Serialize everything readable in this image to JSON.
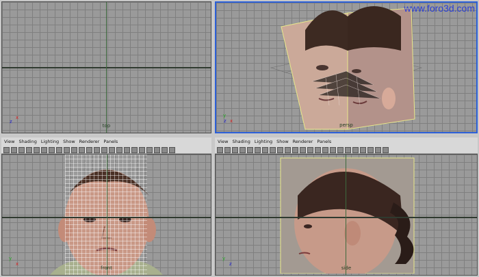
{
  "watermark": "www.foro3d.com",
  "viewports": {
    "top": {
      "label": "top"
    },
    "persp": {
      "label": "persp"
    },
    "front": {
      "label": "front"
    },
    "side": {
      "label": "side"
    }
  },
  "gizmo": {
    "x": "x",
    "y": "y",
    "z": "z"
  },
  "panel_menu": [
    "View",
    "Shading",
    "Lighting",
    "Show",
    "Renderer",
    "Panels"
  ],
  "toolbar_icons": [
    "camera-icon",
    "camera-attr-icon",
    "bookmark-icon",
    "image-plane-icon",
    "grid-icon",
    "film-gate-icon",
    "resolution-gate-icon",
    "gate-mask-icon",
    "field-chart-icon",
    "safe-action-icon",
    "safe-title-icon",
    "wireframe-icon",
    "smooth-shade-icon",
    "flat-shade-icon",
    "bounding-box-icon",
    "points-icon",
    "default-material-icon",
    "textured-icon",
    "lights-icon",
    "shadows-icon",
    "isolate-icon",
    "xray-icon",
    "panel-layout-icon"
  ],
  "colors": {
    "active_border": "#2b5fd8",
    "watermark": "#2a3fd6"
  }
}
